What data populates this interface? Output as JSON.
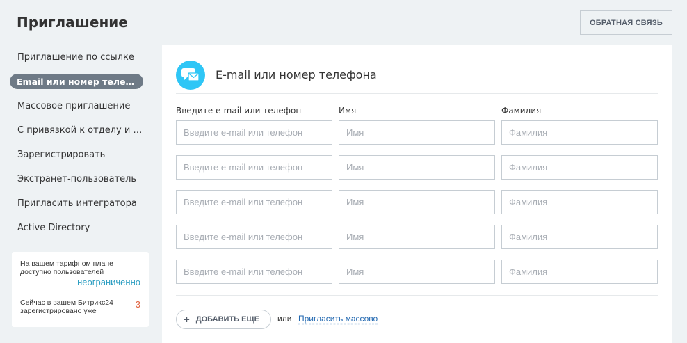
{
  "page": {
    "title": "Приглашение",
    "feedback_label": "ОБРАТНАЯ СВЯЗЬ"
  },
  "sidebar": {
    "items": [
      {
        "label": "Приглашение по ссылке"
      },
      {
        "label": "Email или номер телефона"
      },
      {
        "label": "Массовое приглашение"
      },
      {
        "label": "С привязкой к отделу и группе"
      },
      {
        "label": "Зарегистрировать"
      },
      {
        "label": "Экстранет-пользователь"
      },
      {
        "label": "Пригласить интегратора"
      },
      {
        "label": "Active Directory"
      }
    ],
    "active_index": 1
  },
  "plan": {
    "limit_label": "На вашем тарифном плане доступно пользователей",
    "limit_value": "неограниченно",
    "registered_label": "Сейчас в вашем Битрикс24 зарегистрировано уже",
    "registered_value": "3"
  },
  "form": {
    "title": "E-mail или номер телефона",
    "columns": {
      "email": "Введите e-mail или телефон",
      "first_name": "Имя",
      "last_name": "Фамилия"
    },
    "placeholders": {
      "email": "Введите e-mail или телефон",
      "first_name": "Имя",
      "last_name": "Фамилия"
    },
    "add_more_label": "ДОБАВИТЬ ЕЩЕ",
    "or_label": "или",
    "mass_invite_link": "Пригласить массово"
  },
  "colors": {
    "accent_blue": "#2fc6f6",
    "link": "#2067b0",
    "unlimited": "#2b9ec2",
    "count": "#e05f3b",
    "active_item": "#6e7a86"
  }
}
